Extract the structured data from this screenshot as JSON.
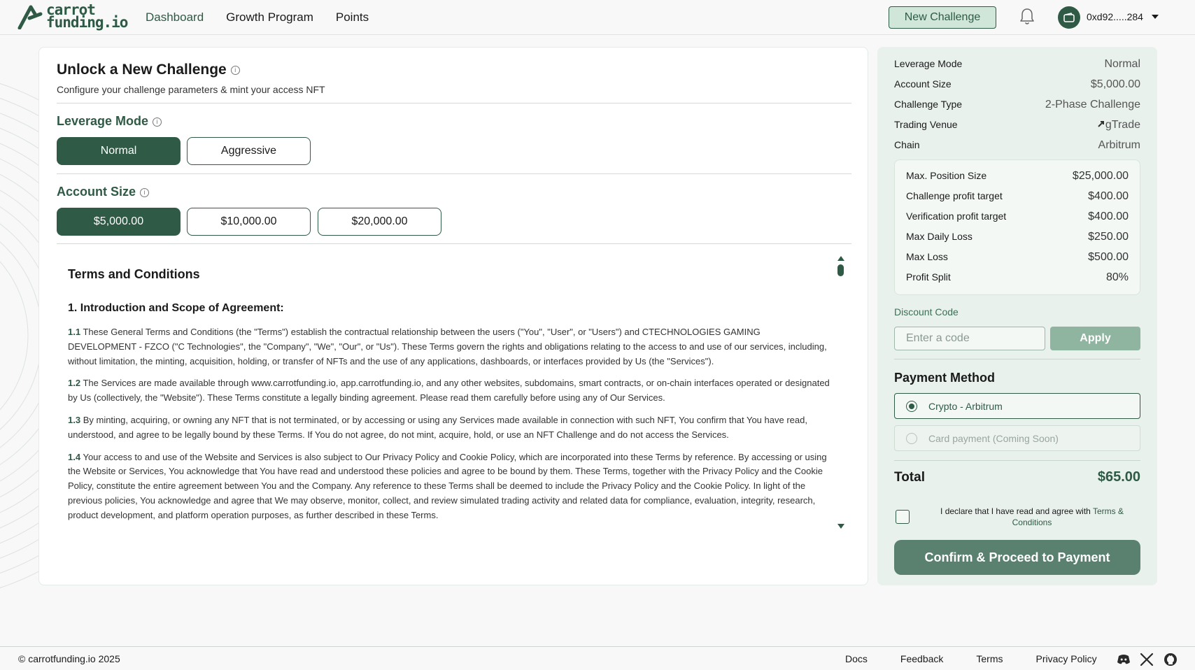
{
  "brand": {
    "name_line1": "carrot",
    "name_line2": "funding.io"
  },
  "nav": [
    {
      "label": "Dashboard",
      "active": true
    },
    {
      "label": "Growth Program",
      "active": false
    },
    {
      "label": "Points",
      "active": false
    }
  ],
  "header": {
    "new_challenge": "New Challenge",
    "wallet_address": "0xd92.....284"
  },
  "main": {
    "title": "Unlock a New Challenge",
    "subtitle": "Configure your challenge parameters & mint your access NFT",
    "leverage": {
      "title": "Leverage Mode",
      "options": [
        "Normal",
        "Aggressive"
      ],
      "selected": "Normal"
    },
    "account_size": {
      "title": "Account Size",
      "options": [
        "$5,000.00",
        "$10,000.00",
        "$20,000.00"
      ],
      "selected": "$5,000.00"
    },
    "terms": {
      "title": "Terms and Conditions",
      "heading": "1. Introduction and Scope of Agreement:",
      "paragraphs": [
        {
          "num": "1.1",
          "text": "These General Terms and Conditions (the \"Terms\") establish the contractual relationship between the users (\"You\", \"User\", or \"Users\") and CTECHNOLOGIES GAMING DEVELOPMENT - FZCO (\"C Technologies\", the \"Company\", \"We\", \"Our\", or \"Us\"). These Terms govern the rights and obligations relating to the access to and use of our services, including, without limitation, the minting, acquisition, holding, or transfer of NFTs and the use of any applications, dashboards, or interfaces provided by Us (the \"Services\")."
        },
        {
          "num": "1.2",
          "text": "The Services are made available through www.carrotfunding.io, app.carrotfunding.io, and any other websites, subdomains, smart contracts, or on-chain interfaces operated or designated by Us (collectively, the \"Website\"). These Terms constitute a legally binding agreement. Please read them carefully before using any of Our Services."
        },
        {
          "num": "1.3",
          "text": "By minting, acquiring, or owning any NFT that is not terminated, or by accessing or using any Services made available in connection with such NFT, You confirm that You have read, understood, and agree to be legally bound by these Terms. If You do not agree, do not mint, acquire, hold, or use an NFT Challenge and do not access the Services."
        },
        {
          "num": "1.4",
          "text": "Your access to and use of the Website and Services is also subject to Our Privacy Policy and Cookie Policy, which are incorporated into these Terms by reference. By accessing or using the Website or Services, You acknowledge that You have read and understood these policies and agree to be bound by them. These Terms, together with the Privacy Policy and the Cookie Policy, constitute the entire agreement between You and the Company. Any reference to these Terms shall be deemed to include the Privacy Policy and the Cookie Policy. In light of the previous policies, You acknowledge and agree that We may observe, monitor, collect, and review simulated trading activity and related data for compliance, evaluation, integrity, research, product development, and platform operation purposes, as further described in these Terms."
        }
      ]
    }
  },
  "summary": {
    "rows": [
      {
        "label": "Leverage Mode",
        "value": "Normal"
      },
      {
        "label": "Account Size",
        "value": "$5,000.00"
      },
      {
        "label": "Challenge Type",
        "value": "2-Phase Challenge"
      },
      {
        "label": "Trading Venue",
        "value": "gTrade"
      },
      {
        "label": "Chain",
        "value": "Arbitrum"
      }
    ],
    "details": [
      {
        "label": "Max. Position Size",
        "value": "$25,000.00"
      },
      {
        "label": "Challenge profit target",
        "value": "$400.00"
      },
      {
        "label": "Verification profit target",
        "value": "$400.00"
      },
      {
        "label": "Max Daily Loss",
        "value": "$250.00"
      },
      {
        "label": "Max Loss",
        "value": "$500.00"
      },
      {
        "label": "Profit Split",
        "value": "80%"
      }
    ],
    "discount": {
      "label": "Discount Code",
      "placeholder": "Enter a code",
      "apply": "Apply"
    },
    "payment": {
      "title": "Payment Method",
      "options": [
        {
          "label": "Crypto - Arbitrum",
          "selected": true
        },
        {
          "label": "Card payment (Coming Soon)",
          "selected": false
        }
      ]
    },
    "total": {
      "label": "Total",
      "value": "$65.00"
    },
    "agree": {
      "text": "I declare that I have read and agree with ",
      "link": "Terms & Conditions",
      "checked": false
    },
    "confirm": "Confirm & Proceed to Payment"
  },
  "footer": {
    "copyright": "© carrotfunding.io 2025",
    "links": [
      "Docs",
      "Feedback",
      "Terms",
      "Privacy Policy"
    ],
    "social_icons": [
      "discord-icon",
      "x-icon",
      "github-icon"
    ]
  },
  "colors": {
    "brand": "#2f5a46",
    "panel": "#e8f1ec",
    "accent_light": "#cfe6d8"
  }
}
